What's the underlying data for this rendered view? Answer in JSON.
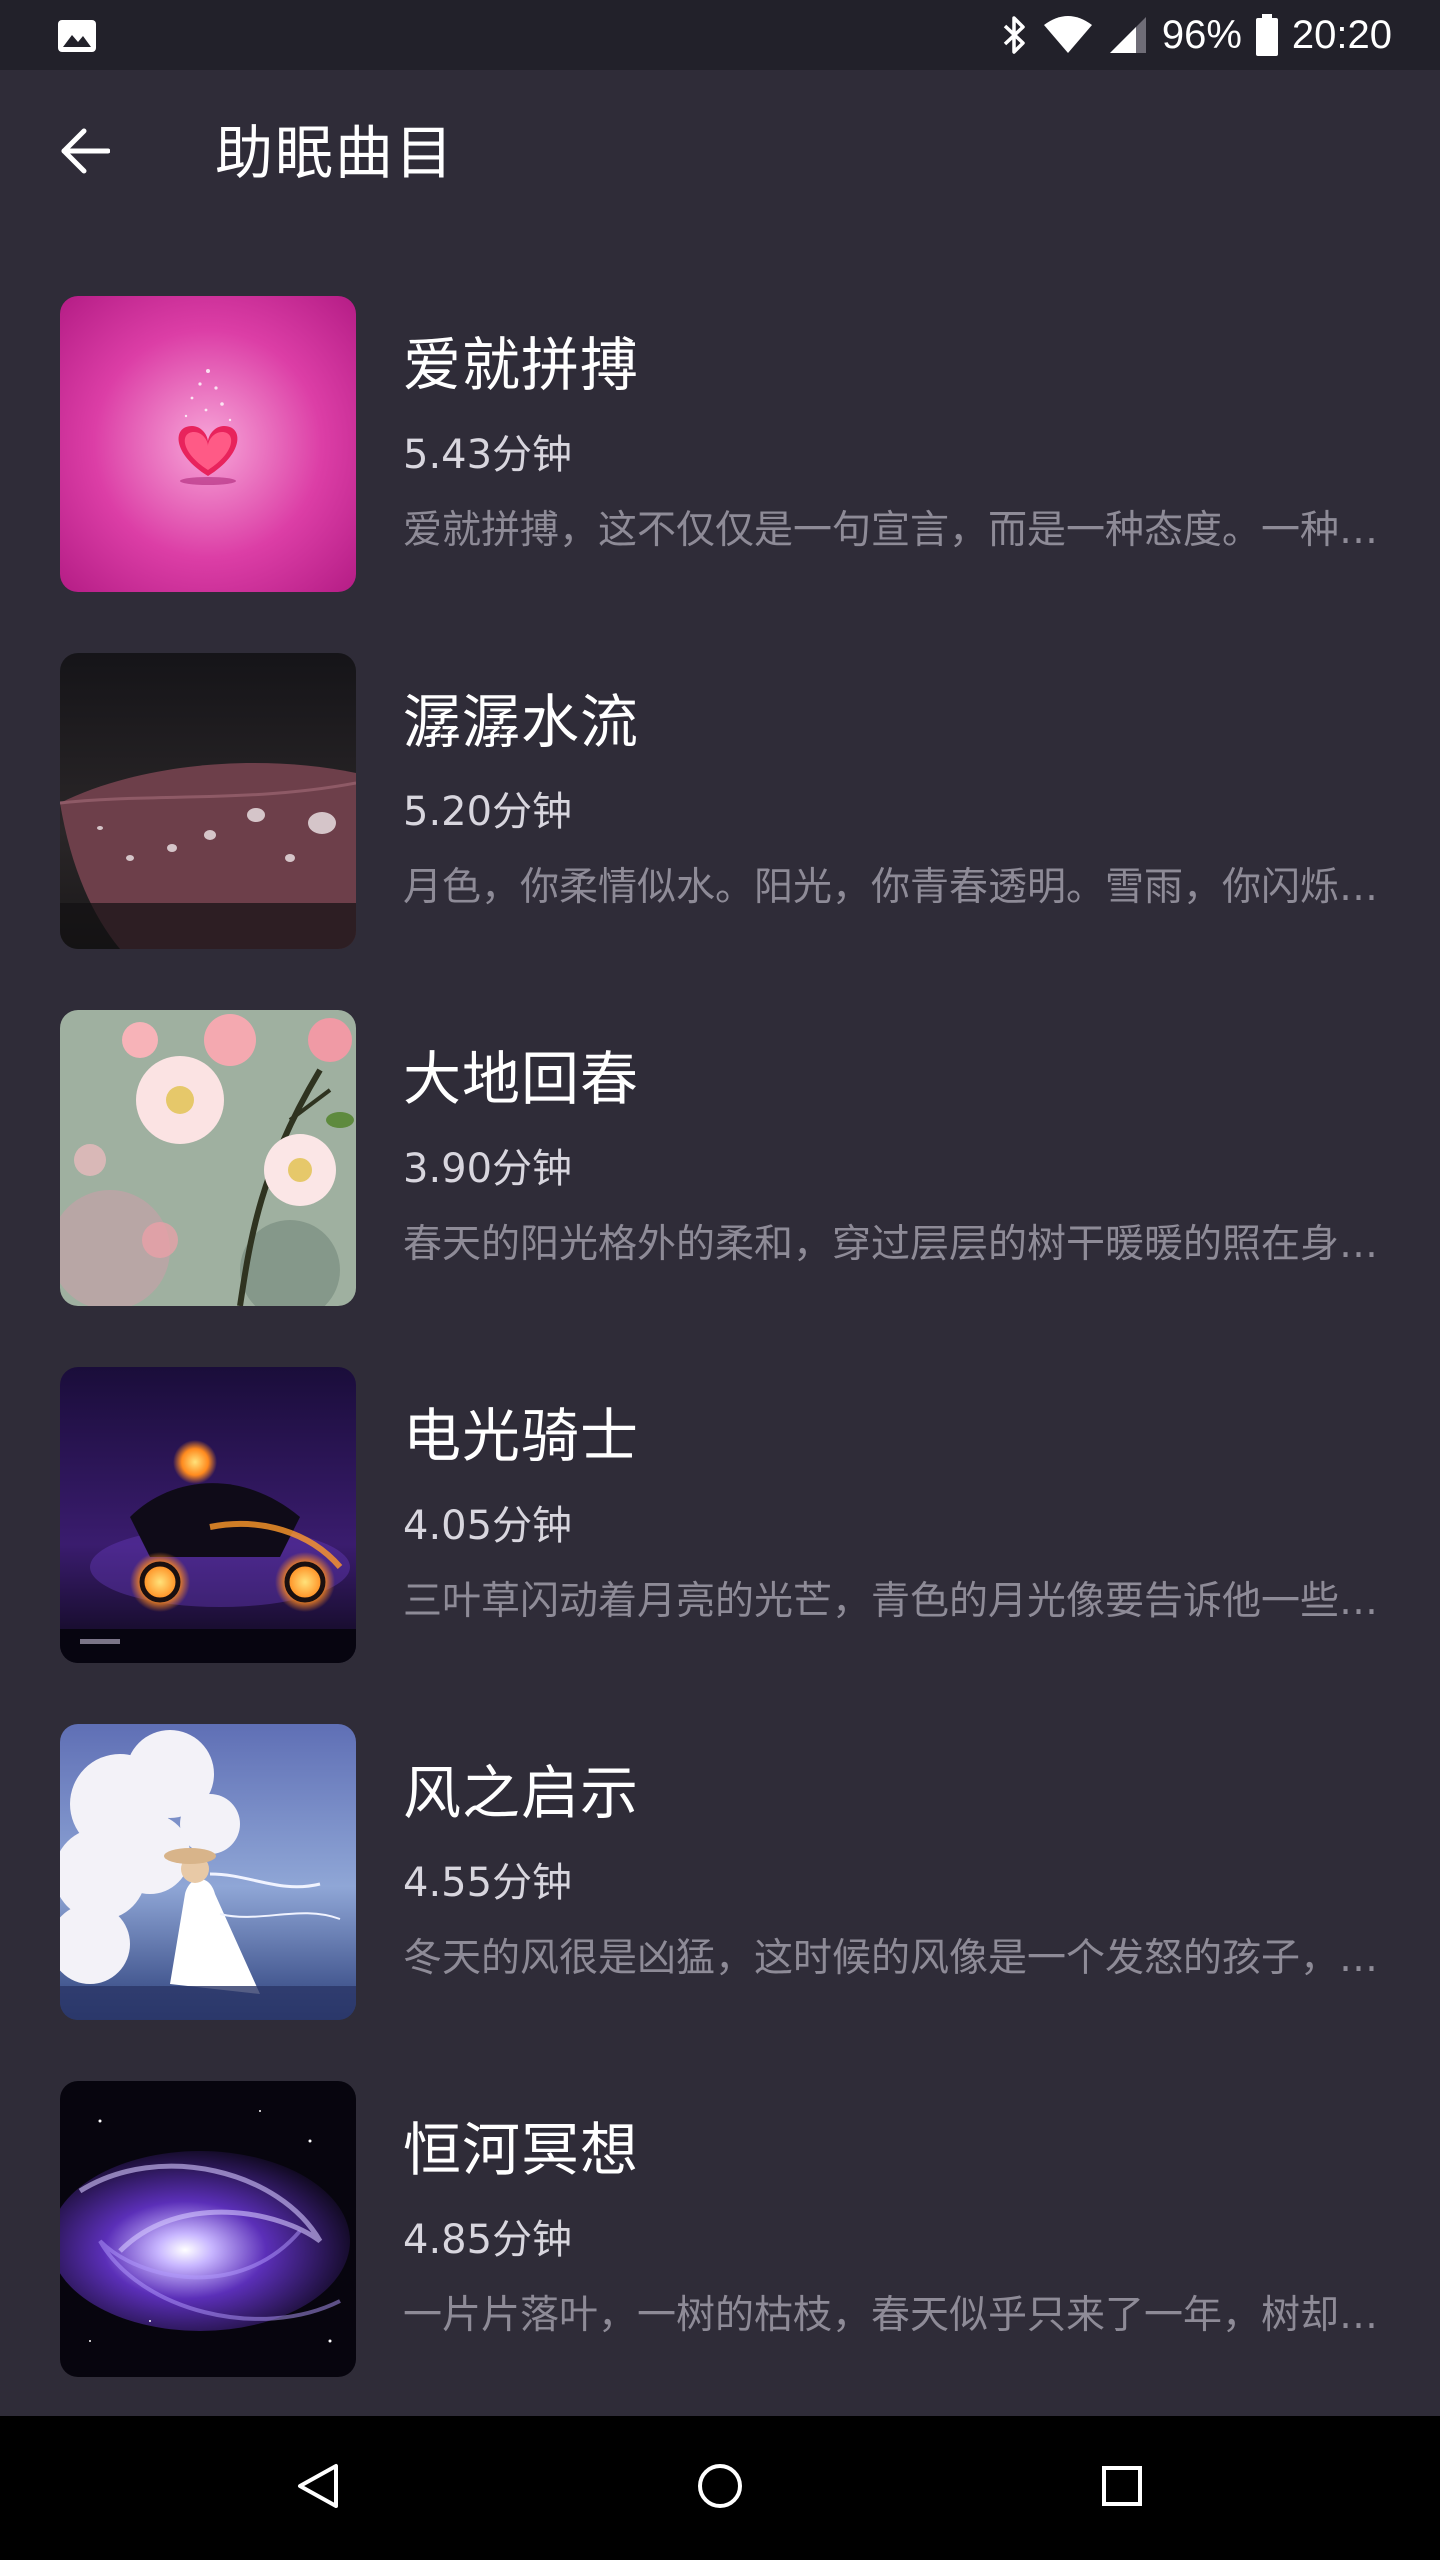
{
  "status_bar": {
    "battery_percent": "96%",
    "time": "20:20",
    "icons": [
      "gallery-icon",
      "bluetooth-icon",
      "wifi-icon",
      "signal-icon",
      "battery-icon"
    ]
  },
  "header": {
    "title": "助眠曲目",
    "back_icon": "arrow-left-icon"
  },
  "tracks": [
    {
      "title": "爱就拼搏",
      "duration": "5.43分钟",
      "description": "爱就拼搏，这不仅仅是一句宣言，而是一种态度。一种坚持。",
      "thumbnail": "pink-heart-valentine"
    },
    {
      "title": "潺潺水流",
      "duration": "5.20分钟",
      "description": "月色，你柔情似水。阳光，你青春透明。雪雨，你闪烁晶莹。",
      "thumbnail": "water-drops-on-leaf"
    },
    {
      "title": "大地回春",
      "duration": "3.90分钟",
      "description": "春天的阳光格外的柔和，穿过层层的树干暖暖的照在身上。",
      "thumbnail": "pink-blossoms"
    },
    {
      "title": "电光骑士",
      "duration": "4.05分钟",
      "description": "三叶草闪动着月亮的光芒，青色的月光像要告诉他一些什么。",
      "thumbnail": "flaming-motorcycle-rider"
    },
    {
      "title": "风之启示",
      "duration": "4.55分钟",
      "description": "冬天的风很是凶猛，这时候的风像是一个发怒的孩子，呼啸而过。",
      "thumbnail": "girl-in-white-dress-clouds"
    },
    {
      "title": "恒河冥想",
      "duration": "4.85分钟",
      "description": "一片片落叶，一树的枯枝，春天似乎只来了一年，树却老了。",
      "thumbnail": "purple-galaxy"
    }
  ],
  "nav_bar": {
    "icons": [
      "back-triangle-icon",
      "home-circle-icon",
      "recents-square-icon"
    ]
  },
  "colors": {
    "background": "#2f2c38",
    "status_bar": "#22212a",
    "title_text": "#ffffff",
    "duration_text": "#d8d6de",
    "description_text": "#8e8b97",
    "nav_bar": "#000000"
  }
}
